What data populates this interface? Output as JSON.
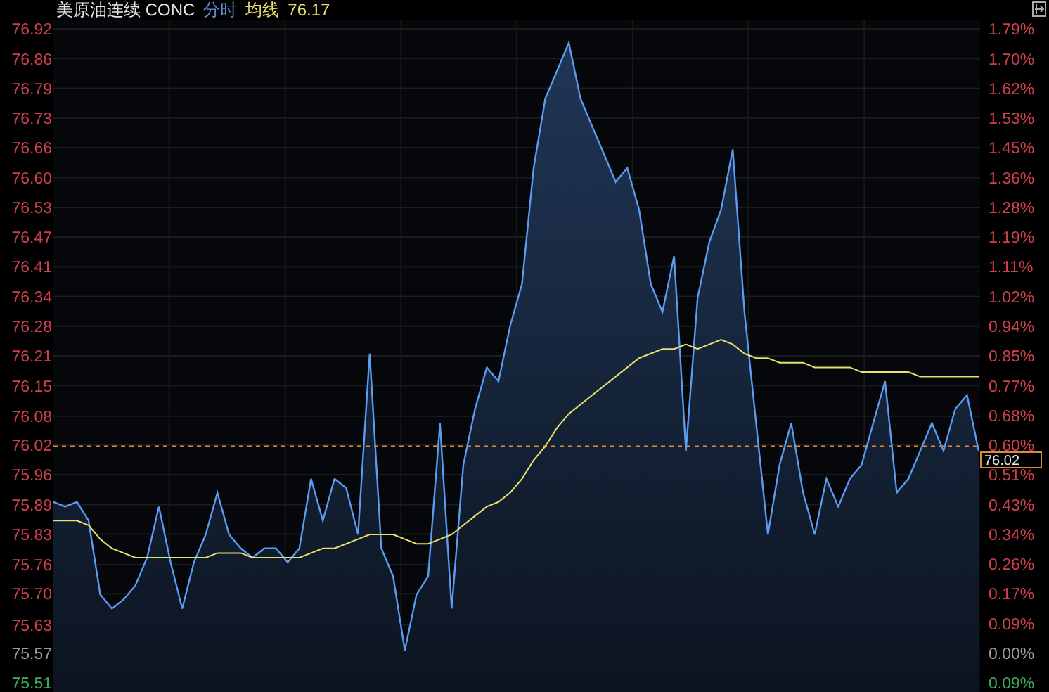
{
  "header": {
    "title": "美原油连续 CONC",
    "average_value": "76.17"
  },
  "percent_axis": [
    {
      "label": "1.79%",
      "kind": "up"
    },
    {
      "label": "1.70%",
      "kind": "up"
    },
    {
      "label": "1.62%",
      "kind": "up"
    },
    {
      "label": "1.53%",
      "kind": "up"
    },
    {
      "label": "1.45%",
      "kind": "up"
    },
    {
      "label": "1.36%",
      "kind": "up"
    },
    {
      "label": "1.28%",
      "kind": "up"
    },
    {
      "label": "1.19%",
      "kind": "up"
    },
    {
      "label": "1.11%",
      "kind": "up"
    },
    {
      "label": "1.02%",
      "kind": "up"
    },
    {
      "label": "0.94%",
      "kind": "up"
    },
    {
      "label": "0.85%",
      "kind": "up"
    },
    {
      "label": "0.77%",
      "kind": "up"
    },
    {
      "label": "0.68%",
      "kind": "up"
    },
    {
      "label": "0.60%",
      "kind": "up"
    },
    {
      "label": "0.51%",
      "kind": "up"
    },
    {
      "label": "0.43%",
      "kind": "up"
    },
    {
      "label": "0.34%",
      "kind": "up"
    },
    {
      "label": "0.26%",
      "kind": "up"
    },
    {
      "label": "0.17%",
      "kind": "up"
    },
    {
      "label": "0.09%",
      "kind": "up"
    },
    {
      "label": "0.00%",
      "kind": "flat"
    },
    {
      "label": "0.09%",
      "kind": "down"
    }
  ],
  "chart_data": {
    "type": "area",
    "ylim": [
      75.51,
      76.92
    ],
    "yticks": [
      {
        "value": 76.92,
        "label": "76.92"
      },
      {
        "value": 76.8559,
        "label": "76.86"
      },
      {
        "value": 76.7918,
        "label": "76.79"
      },
      {
        "value": 76.7277,
        "label": "76.73"
      },
      {
        "value": 76.6636,
        "label": "76.66"
      },
      {
        "value": 76.5995,
        "label": "76.60"
      },
      {
        "value": 76.5349,
        "label": "76.53"
      },
      {
        "value": 76.4714,
        "label": "76.47"
      },
      {
        "value": 76.4073,
        "label": "76.41"
      },
      {
        "value": 76.3432,
        "label": "76.34"
      },
      {
        "value": 76.2791,
        "label": "76.28"
      },
      {
        "value": 76.215,
        "label": "76.21"
      },
      {
        "value": 76.1509,
        "label": "76.15"
      },
      {
        "value": 76.0849,
        "label": "76.08"
      },
      {
        "value": 76.0227,
        "label": "76.02"
      },
      {
        "value": 75.9586,
        "label": "75.96"
      },
      {
        "value": 75.8945,
        "label": "75.89"
      },
      {
        "value": 75.8305,
        "label": "75.83"
      },
      {
        "value": 75.7649,
        "label": "75.76"
      },
      {
        "value": 75.7023,
        "label": "75.70"
      },
      {
        "value": 75.6349,
        "label": "75.63"
      },
      {
        "value": 75.5741,
        "label": "75.57"
      },
      {
        "value": 75.51,
        "label": "75.51"
      }
    ],
    "grid": true,
    "ref_lines": [
      {
        "axis": "y",
        "value": 76.02,
        "label": "76.02",
        "color": "#e08a3c"
      }
    ],
    "series": [
      {
        "name": "分时",
        "type": "area",
        "color": "#5b9bf0",
        "values": [
          75.9,
          75.89,
          75.9,
          75.86,
          75.7,
          75.67,
          75.69,
          75.72,
          75.78,
          75.89,
          75.77,
          75.67,
          75.77,
          75.83,
          75.92,
          75.83,
          75.8,
          75.78,
          75.8,
          75.8,
          75.77,
          75.8,
          75.95,
          75.86,
          75.95,
          75.93,
          75.83,
          76.22,
          75.8,
          75.74,
          75.58,
          75.7,
          75.74,
          76.07,
          75.67,
          75.98,
          76.1,
          76.19,
          76.16,
          76.28,
          76.37,
          76.62,
          76.77,
          76.83,
          76.89,
          76.77,
          76.71,
          76.65,
          76.59,
          76.62,
          76.53,
          76.37,
          76.31,
          76.43,
          76.01,
          76.34,
          76.46,
          76.53,
          76.66,
          76.31,
          76.07,
          75.83,
          75.98,
          76.07,
          75.92,
          75.83,
          75.95,
          75.89,
          75.95,
          75.98,
          76.07,
          76.16,
          75.92,
          75.95,
          76.01,
          76.07,
          76.01,
          76.1,
          76.13,
          76.01
        ]
      },
      {
        "name": "均线",
        "type": "line",
        "color": "#e8e070",
        "values": [
          75.86,
          75.86,
          75.86,
          75.85,
          75.82,
          75.8,
          75.79,
          75.78,
          75.78,
          75.78,
          75.78,
          75.78,
          75.78,
          75.78,
          75.79,
          75.79,
          75.79,
          75.78,
          75.78,
          75.78,
          75.78,
          75.78,
          75.79,
          75.8,
          75.8,
          75.81,
          75.82,
          75.83,
          75.83,
          75.83,
          75.82,
          75.81,
          75.81,
          75.82,
          75.83,
          75.85,
          75.87,
          75.89,
          75.9,
          75.92,
          75.95,
          75.99,
          76.02,
          76.06,
          76.09,
          76.11,
          76.13,
          76.15,
          76.17,
          76.19,
          76.21,
          76.22,
          76.23,
          76.23,
          76.24,
          76.23,
          76.24,
          76.25,
          76.24,
          76.22,
          76.21,
          76.21,
          76.2,
          76.2,
          76.2,
          76.19,
          76.19,
          76.19,
          76.19,
          76.18,
          76.18,
          76.18,
          76.18,
          76.18,
          76.17,
          76.17,
          76.17,
          76.17,
          76.17,
          76.17
        ]
      }
    ]
  }
}
